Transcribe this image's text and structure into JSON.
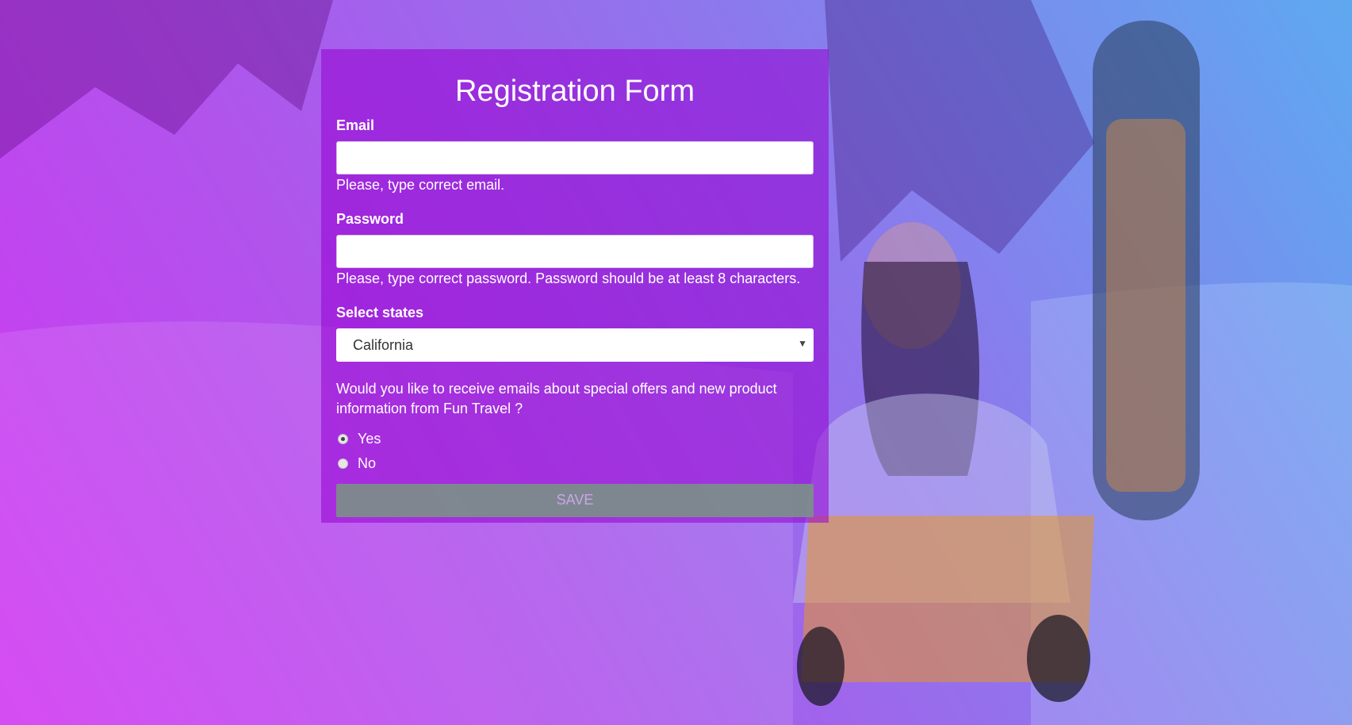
{
  "form": {
    "title": "Registration Form",
    "email": {
      "label": "Email",
      "value": "",
      "hint": "Please, type correct email."
    },
    "password": {
      "label": "Password",
      "value": "",
      "hint": "Please, type correct password. Password should be at least 8 characters."
    },
    "states": {
      "label": "Select states",
      "selected": "California"
    },
    "offers": {
      "question": "Would you like to receive emails about special offers and new product information from Fun Travel ?",
      "options": [
        {
          "label": "Yes",
          "checked": true
        },
        {
          "label": "No",
          "checked": false
        }
      ]
    },
    "save_label": "SAVE"
  },
  "colors": {
    "gradient_left": "#c814f0",
    "gradient_right": "#288ceb",
    "card": "#9600d2",
    "button": "#789682"
  },
  "icons": {
    "select_caret": "chevron-down-icon"
  }
}
